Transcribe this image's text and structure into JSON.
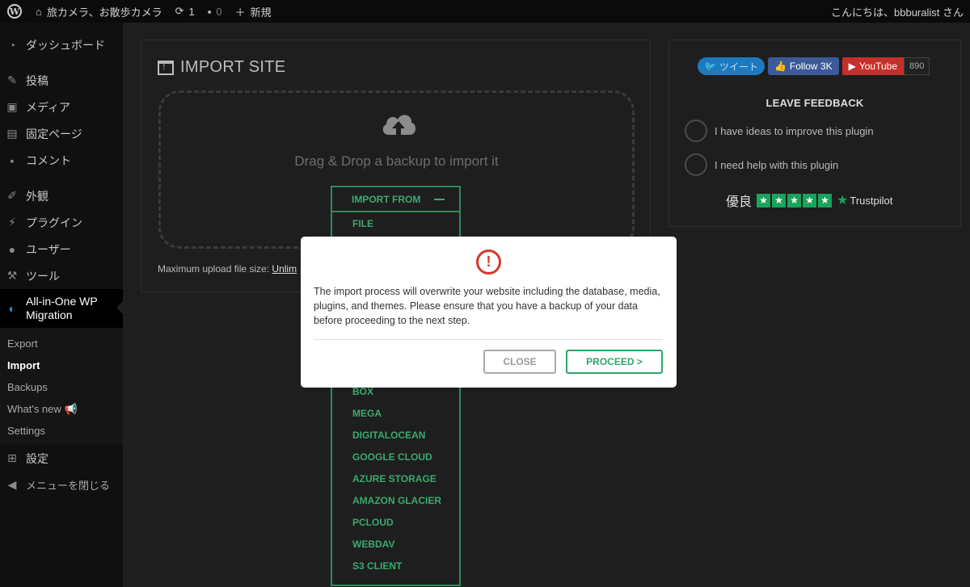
{
  "adminbar": {
    "site_name": "旅カメラ、お散歩カメラ",
    "updates_count": "1",
    "comments_count": "0",
    "new_label": "新規",
    "greeting": "こんにちは、bbburalist さん"
  },
  "sidebar": {
    "items": [
      {
        "label": "ダッシュボード",
        "icon": "dashboard-icon"
      },
      {
        "label": "投稿",
        "icon": "pin-icon"
      },
      {
        "label": "メディア",
        "icon": "media-icon"
      },
      {
        "label": "固定ページ",
        "icon": "page-icon"
      },
      {
        "label": "コメント",
        "icon": "comment-icon"
      },
      {
        "label": "外観",
        "icon": "brush-icon"
      },
      {
        "label": "プラグイン",
        "icon": "plugin-icon"
      },
      {
        "label": "ユーザー",
        "icon": "user-icon"
      },
      {
        "label": "ツール",
        "icon": "wrench-icon"
      },
      {
        "label": "All-in-One WP Migration",
        "icon": "migration-icon"
      },
      {
        "label": "設定",
        "icon": "settings-icon"
      },
      {
        "label": "メニューを閉じる",
        "icon": "collapse-icon"
      }
    ],
    "submenu": [
      "Export",
      "Import",
      "Backups",
      "What's new",
      "Settings"
    ]
  },
  "import": {
    "title": "IMPORT SITE",
    "drop_text": "Drag & Drop a backup to import it",
    "max_upload_label": "Maximum upload file size:",
    "max_upload_value": "Unlim",
    "menu_header": "IMPORT FROM",
    "options_top": [
      "FILE"
    ],
    "options_bottom": [
      "BOX",
      "MEGA",
      "DIGITALOCEAN",
      "GOOGLE CLOUD",
      "AZURE STORAGE",
      "AMAZON GLACIER",
      "PCLOUD",
      "WEBDAV",
      "S3 CLIENT"
    ]
  },
  "feedback": {
    "tweet": "ツイート",
    "follow": "Follow 3K",
    "youtube": "YouTube",
    "youtube_count": "890",
    "title": "LEAVE FEEDBACK",
    "option1": "I have ideas to improve this plugin",
    "option2": "I need help with this plugin",
    "rating_label": "優良",
    "trustpilot": "Trustpilot"
  },
  "modal": {
    "message": "The import process will overwrite your website including the database, media, plugins, and themes. Please ensure that you have a backup of your data before proceeding to the next step.",
    "close_label": "CLOSE",
    "proceed_label": "PROCEED >"
  },
  "colors": {
    "accent_green": "#2da76a",
    "warning_red": "#d9362c",
    "sidebar_bg": "#101010",
    "content_bg": "#1e1e1e"
  }
}
